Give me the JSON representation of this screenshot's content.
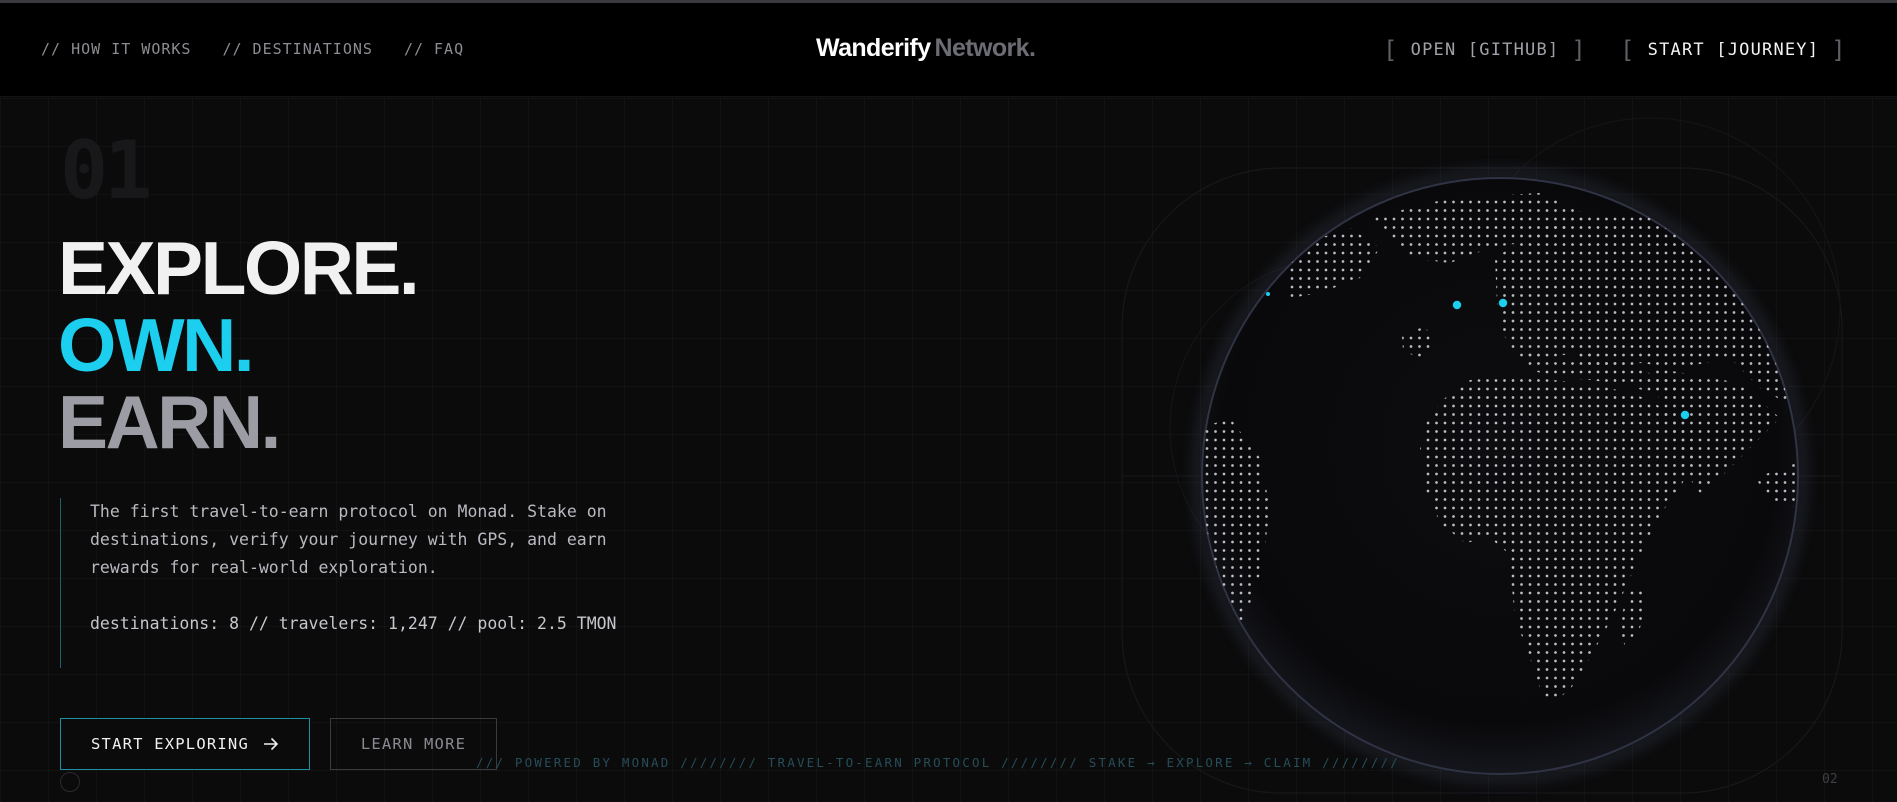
{
  "nav": {
    "items": [
      "// HOW IT WORKS",
      "// DESTINATIONS",
      "// FAQ"
    ]
  },
  "brand": {
    "primary": "Wanderify",
    "secondary": "Network."
  },
  "header_buttons": {
    "github": "OPEN [GITHUB]",
    "journey": "START [JOURNEY]",
    "bracket_open": "[",
    "bracket_close": "]"
  },
  "hero": {
    "number": "01",
    "headline": [
      "EXPLORE.",
      "OWN.",
      "EARN."
    ],
    "description": "The first travel-to-earn protocol on Monad. Stake on destinations, verify your journey with GPS, and earn rewards for real-world exploration.",
    "stats": "destinations: 8 // travelers: 1,247 // pool: 2.5 TMON",
    "primary_button": "START EXPLORING",
    "secondary_button": "LEARN MORE",
    "ticker": "/// POWERED BY MONAD //////// TRAVEL-TO-EARN PROTOCOL //////// STAKE → EXPLORE → CLAIM ////////",
    "page_number": "02"
  },
  "icons": {
    "primary_button_icon": "arrow-right-icon",
    "footer_icon": "circle-outline-icon"
  },
  "colors": {
    "accent": "#1ccfee",
    "background": "#0b0b0c",
    "header": "#000000",
    "muted_text": "#9b9ca4"
  }
}
